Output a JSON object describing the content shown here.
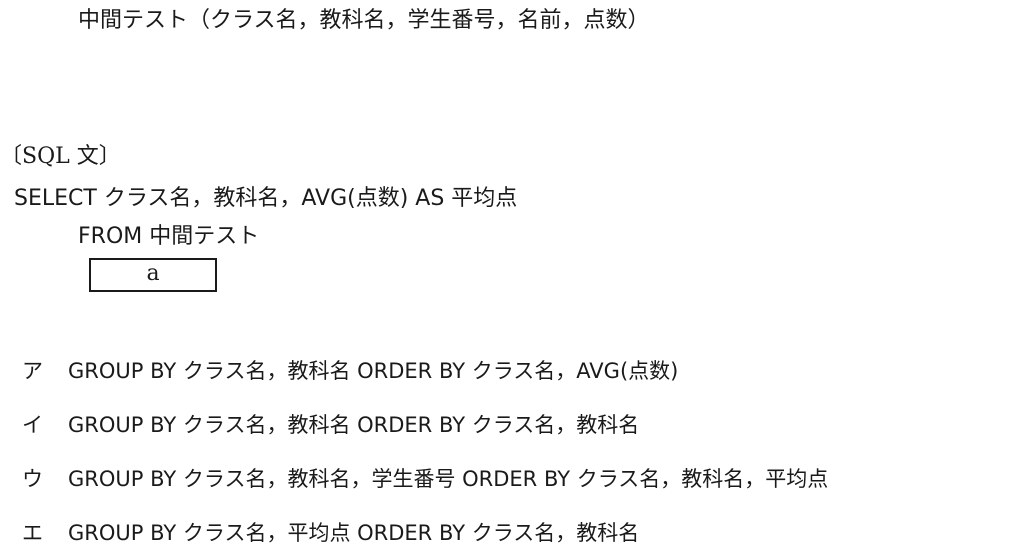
{
  "table_definition": "中間テスト（クラス名，教科名，学生番号，名前，点数）",
  "sql_heading": "〔SQL 文〕",
  "sql_lines": {
    "select": "SELECT クラス名，教科名，AVG(点数) AS 平均点",
    "from": "FROM 中間テスト"
  },
  "blank_label": "a",
  "options": [
    {
      "mark": "ア",
      "text": "GROUP BY クラス名，教科名 ORDER BY クラス名，AVG(点数)"
    },
    {
      "mark": "イ",
      "text": "GROUP BY クラス名，教科名 ORDER BY クラス名，教科名"
    },
    {
      "mark": "ウ",
      "text": "GROUP BY クラス名，教科名，学生番号 ORDER BY クラス名，教科名，平均点"
    },
    {
      "mark": "エ",
      "text": "GROUP BY クラス名，平均点 ORDER BY クラス名，教科名"
    }
  ]
}
